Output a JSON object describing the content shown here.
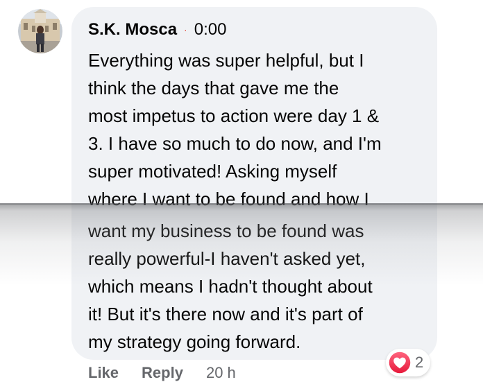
{
  "comment": {
    "author": "S.K. Mosca",
    "separator": "·",
    "timestamp": "0:00",
    "lines": [
      "Everything was super helpful, but I",
      "think the days that gave me the",
      "most impetus to action were day 1 &",
      "3. I have so much to do now, and I'm",
      "super motivated! Asking myself",
      "where I want to be found and how I",
      "want my business to be found was",
      "really powerful-I haven't asked yet,",
      "which means I hadn't thought about",
      "it! But it's there now and it's part of",
      "my strategy going forward."
    ]
  },
  "actions": {
    "like_label": "Like",
    "reply_label": "Reply",
    "age": "20 h"
  },
  "reactions": {
    "icon": "heart-icon",
    "count": "2"
  },
  "colors": {
    "bubble": "#f0f2f5",
    "text": "#050505",
    "muted": "#65676b",
    "heart": "#f33e58",
    "dot": "#e4483b"
  }
}
